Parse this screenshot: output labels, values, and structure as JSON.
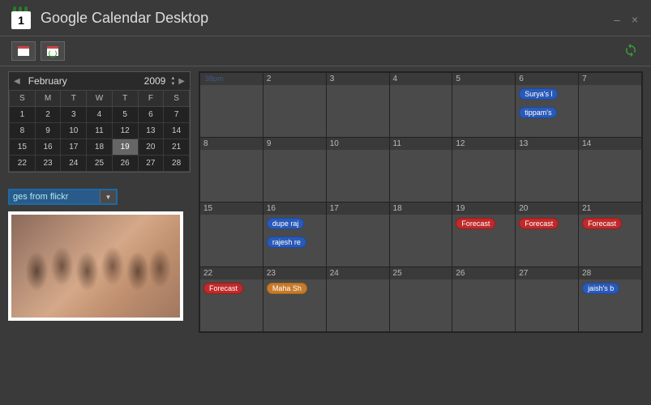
{
  "app": {
    "title": "Google Calendar Desktop",
    "logo_day": "1"
  },
  "mini_calendar": {
    "month": "February",
    "year": "2009",
    "day_headers": [
      "S",
      "M",
      "T",
      "W",
      "T",
      "F",
      "S"
    ],
    "weeks": [
      [
        "1",
        "2",
        "3",
        "4",
        "5",
        "6",
        "7"
      ],
      [
        "8",
        "9",
        "10",
        "11",
        "12",
        "13",
        "14"
      ],
      [
        "15",
        "16",
        "17",
        "18",
        "19",
        "20",
        "21"
      ],
      [
        "22",
        "23",
        "24",
        "25",
        "26",
        "27",
        "28"
      ]
    ],
    "selected_day": "19"
  },
  "dropdown": {
    "value": "ges from flickr"
  },
  "big_calendar": {
    "weeks": [
      [
        {
          "num": "",
          "events": [],
          "faint": "38pm"
        },
        {
          "num": "2",
          "events": []
        },
        {
          "num": "3",
          "events": []
        },
        {
          "num": "4",
          "events": []
        },
        {
          "num": "5",
          "events": []
        },
        {
          "num": "6",
          "events": [
            {
              "label": "Surya's l",
              "color": "blue"
            },
            {
              "label": "tippam's",
              "color": "blue"
            }
          ]
        },
        {
          "num": "7",
          "events": []
        }
      ],
      [
        {
          "num": "8",
          "events": []
        },
        {
          "num": "9",
          "events": []
        },
        {
          "num": "10",
          "events": []
        },
        {
          "num": "11",
          "events": []
        },
        {
          "num": "12",
          "events": []
        },
        {
          "num": "13",
          "events": []
        },
        {
          "num": "14",
          "events": []
        }
      ],
      [
        {
          "num": "15",
          "events": [],
          "faint": ""
        },
        {
          "num": "16",
          "events": [
            {
              "label": "dupe raj",
              "color": "blue"
            },
            {
              "label": "rajesh re",
              "color": "blue"
            }
          ]
        },
        {
          "num": "17",
          "events": []
        },
        {
          "num": "18",
          "events": []
        },
        {
          "num": "19",
          "events": [
            {
              "label": "Forecast",
              "color": "red"
            }
          ]
        },
        {
          "num": "20",
          "events": [
            {
              "label": "Forecast",
              "color": "red"
            }
          ]
        },
        {
          "num": "21",
          "events": [
            {
              "label": "Forecast",
              "color": "red"
            }
          ]
        }
      ],
      [
        {
          "num": "22",
          "events": [
            {
              "label": "Forecast",
              "color": "red"
            }
          ]
        },
        {
          "num": "23",
          "events": [
            {
              "label": "Maha Sh",
              "color": "orange"
            }
          ]
        },
        {
          "num": "24",
          "events": []
        },
        {
          "num": "25",
          "events": []
        },
        {
          "num": "26",
          "events": []
        },
        {
          "num": "27",
          "events": []
        },
        {
          "num": "28",
          "events": [
            {
              "label": "jaish's b",
              "color": "blue"
            }
          ]
        }
      ]
    ]
  }
}
